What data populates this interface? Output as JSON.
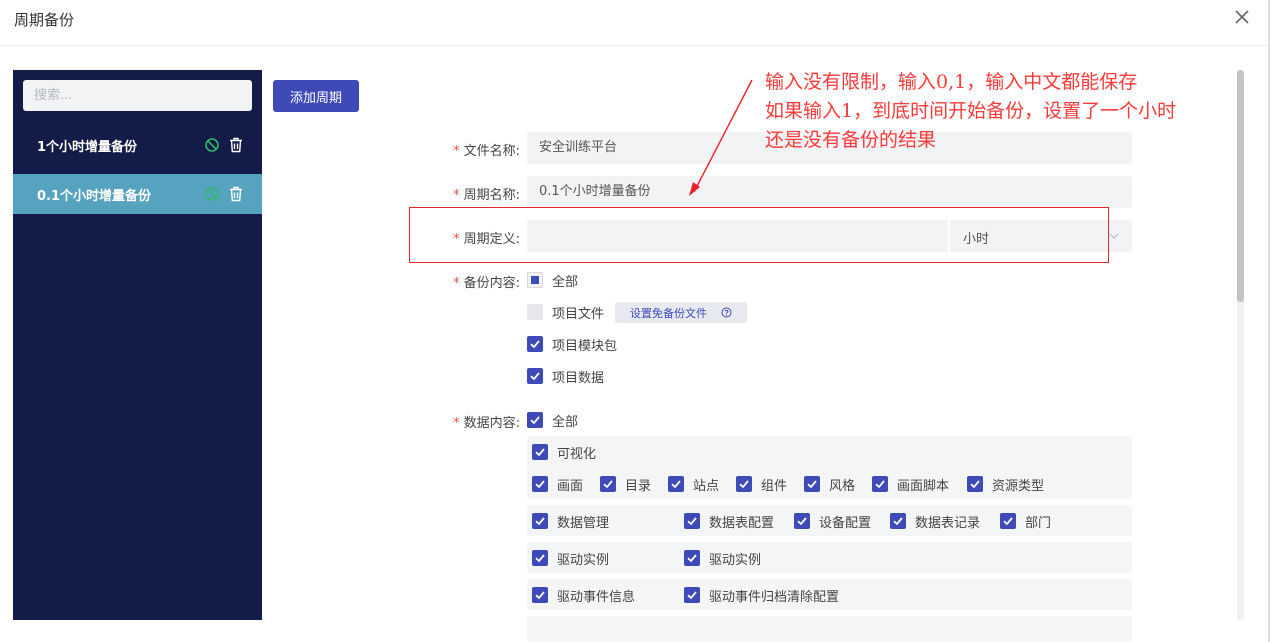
{
  "dialog": {
    "title": "周期备份"
  },
  "sidebar": {
    "search_placeholder": "搜索...",
    "items": [
      {
        "label": "1个小时增量备份",
        "active": false
      },
      {
        "label": "0.1个小时增量备份",
        "active": true
      }
    ]
  },
  "toolbar": {
    "add_label": "添加周期"
  },
  "form": {
    "file_name": {
      "label": "文件名称:",
      "value": "安全训练平台"
    },
    "cycle_name": {
      "label": "周期名称:",
      "value": "0.1个小时增量备份"
    },
    "cycle_def": {
      "label": "周期定义:",
      "value": "",
      "unit": "小时"
    },
    "backup_content": {
      "label": "备份内容:",
      "all_label": "全部",
      "options": [
        {
          "label": "项目文件",
          "checked": false
        },
        {
          "label": "项目模块包",
          "checked": true
        },
        {
          "label": "项目数据",
          "checked": true
        }
      ],
      "exempt_button": "设置免备份文件"
    },
    "data_content": {
      "label": "数据内容:",
      "all_label": "全部",
      "visualization": {
        "label": "可视化",
        "items": [
          "画面",
          "目录",
          "站点",
          "组件",
          "风格",
          "画面脚本",
          "资源类型"
        ]
      },
      "row_data": [
        "数据管理",
        "数据表配置",
        "设备配置",
        "数据表记录",
        "部门"
      ],
      "row_driver": [
        "驱动实例",
        "驱动实例"
      ],
      "row_event": [
        "驱动事件信息",
        "驱动事件归档清除配置"
      ]
    }
  },
  "annotation": {
    "lines": [
      "输入没有限制，输入0,1，输入中文都能保存",
      "如果输入1，到底时间开始备份，设置了一个小时",
      "还是没有备份的结果"
    ],
    "color": "#ff3a3a"
  },
  "colors": {
    "primary": "#3d4ab8",
    "sidebar": "#131b48",
    "active_item": "#56a3c0",
    "enabled_icon": "#2fb86a",
    "required": "#e34d4d"
  }
}
